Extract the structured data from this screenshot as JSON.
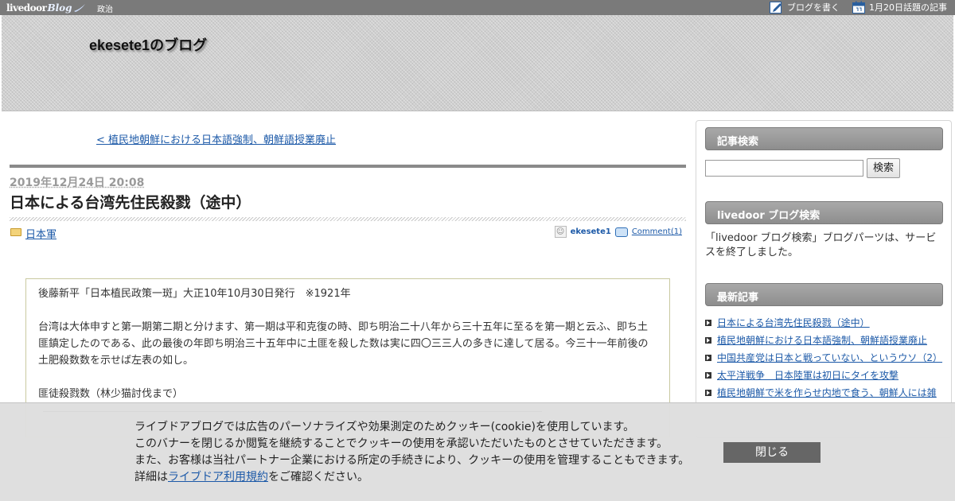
{
  "topbar": {
    "logo_livedoor": "livedoor",
    "logo_blog": "Blog",
    "category": "政治",
    "write_blog": "ブログを書く",
    "trending": "1月20日話題の記事"
  },
  "header": {
    "blog_title": "ekesete1のブログ"
  },
  "main": {
    "prev_link": "< 植民地朝鮮における日本語強制、朝鮮語授業廃止",
    "date": "2019年12月24日 20:08",
    "title": "日本による台湾先住民殺戮（途中）",
    "category": "日本軍",
    "author": "ekesete1",
    "comments": "Comment(1)",
    "article": {
      "para1": "後藤新平「日本植民政策一斑」大正10年10月30日発行　※1921年",
      "para2": "台湾は大体申すと第一期第二期と分けます、第一期は平和克復の時、即ち明治二十八年から三十五年に至るを第一期と云ふ、即ち土匪鎮定したのである、此の最後の年即ち明治三十五年中に土匪を殺した数は実に四〇三三人の多きに達して居る。今三十一年前後の土肥殺数数を示せば左表の如し。",
      "para3": "匪徒殺戮数（林少猫討伐まで）"
    }
  },
  "sidebar": {
    "search_heading": "記事検索",
    "search_button": "検索",
    "search_placeholder": "",
    "livedoor_search_heading": "livedoor ブログ検索",
    "livedoor_search_text": "「livedoor ブログ検索」ブログパーツは、サービスを終了しました。",
    "recent_heading": "最新記事",
    "recent_items": [
      "日本による台湾先住民殺戮（途中）",
      "植民地朝鮮における日本語強制、朝鮮語授業廃止",
      "中国共産党は日本と戦っていない、というウソ（2）",
      "太平洋戦争　日本陸軍は初日にタイを攻撃",
      "植民地朝鮮で米を作らせ内地で食う、朝鮮人には雑"
    ]
  },
  "cookie_banner": {
    "line1": "ライブドアブログでは広告のパーソナライズや効果測定のためクッキー(cookie)を使用しています。",
    "line2": "このバナーを閉じるか閲覧を継続することでクッキーの使用を承認いただいたものとさせていただきます。",
    "line3": "また、お客様は当社パートナー企業における所定の手続きにより、クッキーの使用を管理することもできます。",
    "line4_prefix": "詳細は",
    "line4_link": "ライブドア利用規約",
    "line4_suffix": "をご確認ください。",
    "close_button": "閉じる"
  }
}
